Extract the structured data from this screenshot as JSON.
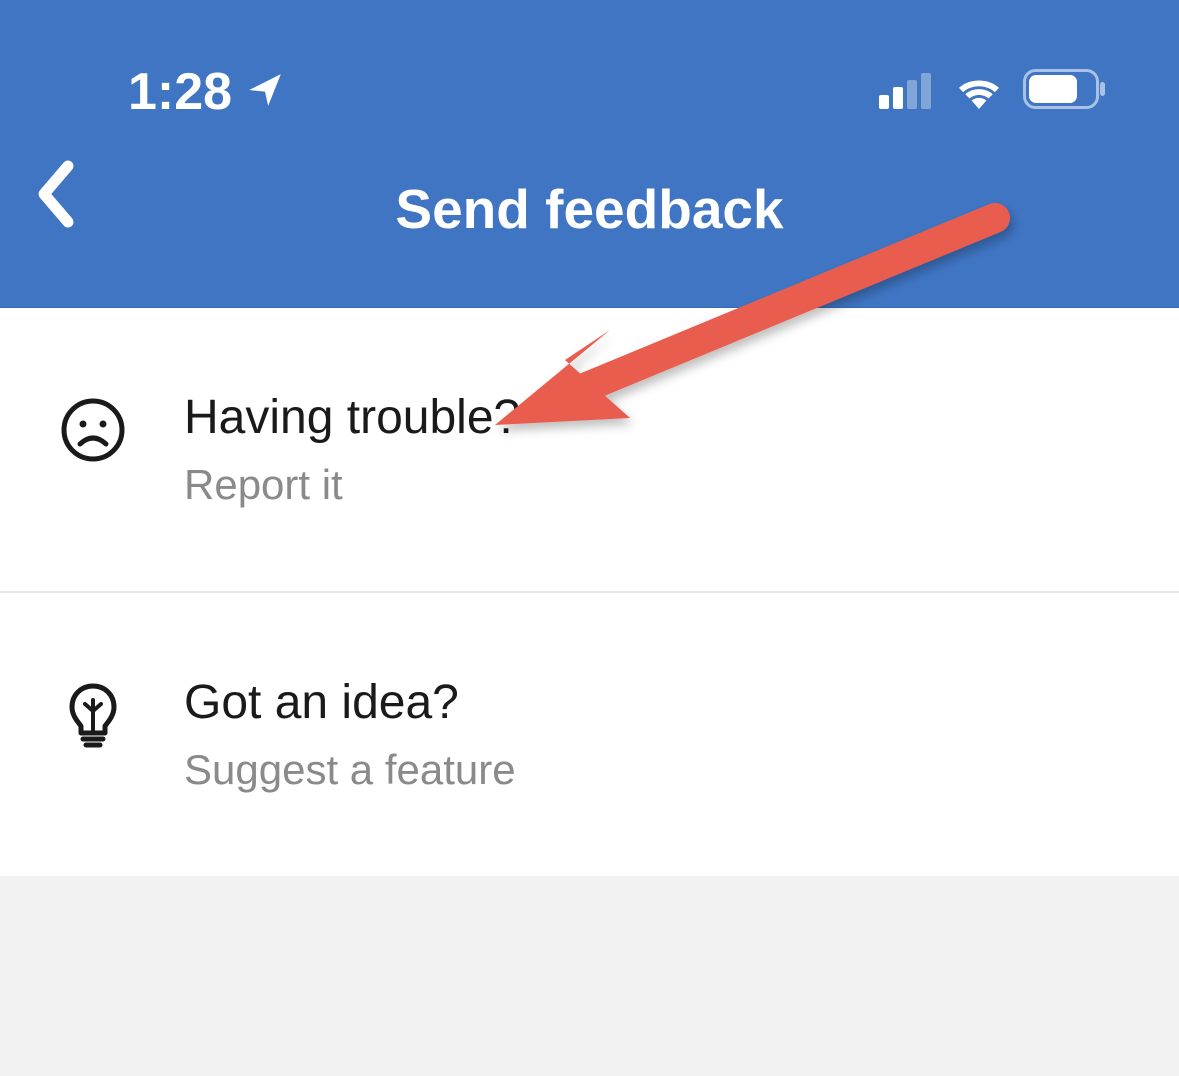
{
  "status_bar": {
    "time": "1:28"
  },
  "header": {
    "title": "Send feedback"
  },
  "options": [
    {
      "title": "Having trouble?",
      "subtitle": "Report it"
    },
    {
      "title": "Got an idea?",
      "subtitle": "Suggest a feature"
    }
  ]
}
